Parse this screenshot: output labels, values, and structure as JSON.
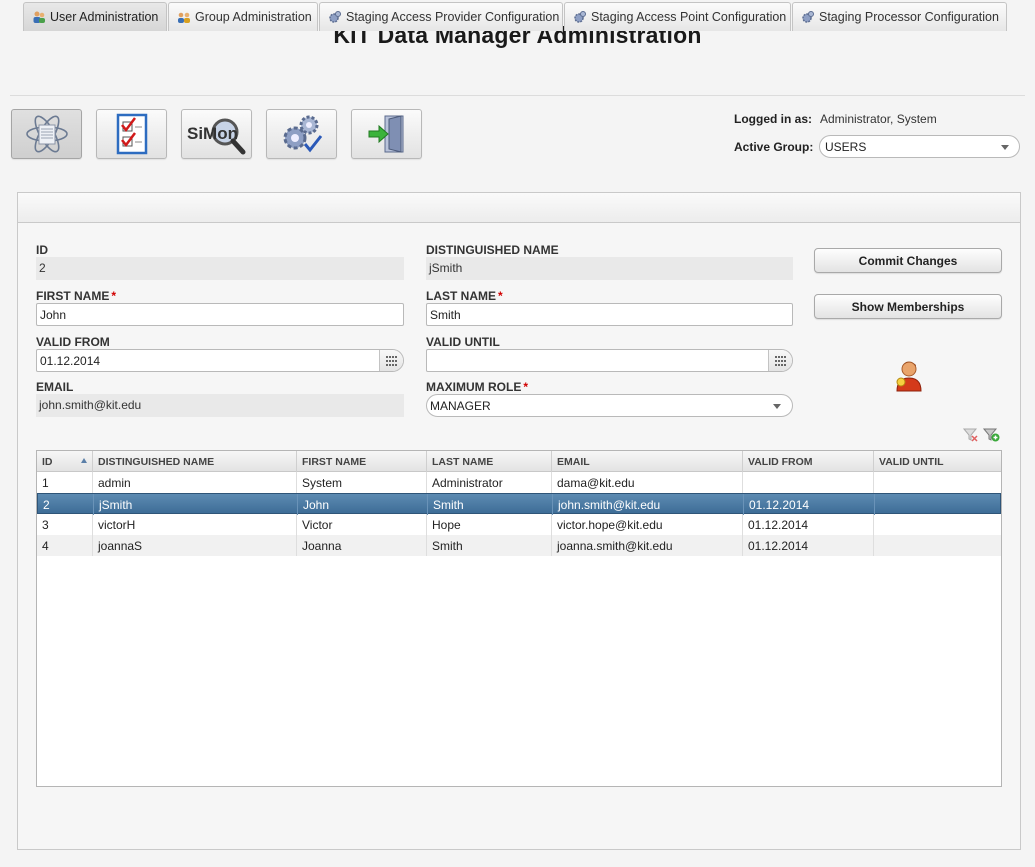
{
  "app": {
    "title": "KIT Data Manager Administration"
  },
  "toolbar": {
    "buttons": [
      {
        "name": "atom-data-icon"
      },
      {
        "name": "checklist-icon"
      },
      {
        "name": "simon-search-icon",
        "text": "SiMon"
      },
      {
        "name": "gears-settings-icon"
      },
      {
        "name": "logout-door-icon"
      }
    ]
  },
  "session": {
    "logged_in_label": "Logged in as:",
    "logged_in_value": "Administrator, System",
    "active_group_label": "Active Group:",
    "active_group_value": "USERS"
  },
  "tabs": [
    {
      "label": "User Administration",
      "icon": "users-icon",
      "active": true
    },
    {
      "label": "Group Administration",
      "icon": "group-icon",
      "active": false
    },
    {
      "label": "Staging Access Provider Configuration",
      "icon": "gear-icon",
      "active": false
    },
    {
      "label": "Staging Access Point Configuration",
      "icon": "gear-icon",
      "active": false
    },
    {
      "label": "Staging Processor Configuration",
      "icon": "gear-icon",
      "active": false
    }
  ],
  "form": {
    "id_label": "ID",
    "id_value": "2",
    "dn_label": "DISTINGUISHED NAME",
    "dn_value": "jSmith",
    "first_name_label": "FIRST NAME",
    "first_name_value": "John",
    "last_name_label": "LAST NAME",
    "last_name_value": "Smith",
    "valid_from_label": "VALID FROM",
    "valid_from_value": "01.12.2014",
    "valid_until_label": "VALID UNTIL",
    "valid_until_value": "",
    "email_label": "EMAIL",
    "email_value": "john.smith@kit.edu",
    "max_role_label": "MAXIMUM ROLE",
    "max_role_value": "MANAGER",
    "required_mark": "*"
  },
  "actions": {
    "commit_label": "Commit Changes",
    "memberships_label": "Show Memberships"
  },
  "colors": {
    "selected_row": "#4a7aa3",
    "required": "#d10000"
  },
  "table": {
    "columns": [
      "ID",
      "DISTINGUISHED NAME",
      "FIRST NAME",
      "LAST NAME",
      "EMAIL",
      "VALID FROM",
      "VALID UNTIL"
    ],
    "rows": [
      [
        "1",
        "admin",
        "System",
        "Administrator",
        "dama@kit.edu",
        "",
        ""
      ],
      [
        "2",
        "jSmith",
        "John",
        "Smith",
        "john.smith@kit.edu",
        "01.12.2014",
        ""
      ],
      [
        "3",
        "victorH",
        "Victor",
        "Hope",
        "victor.hope@kit.edu",
        "01.12.2014",
        ""
      ],
      [
        "4",
        "joannaS",
        "Joanna",
        "Smith",
        "joanna.smith@kit.edu",
        "01.12.2014",
        ""
      ]
    ],
    "selected_index": 1,
    "sorted_column": "ID"
  }
}
